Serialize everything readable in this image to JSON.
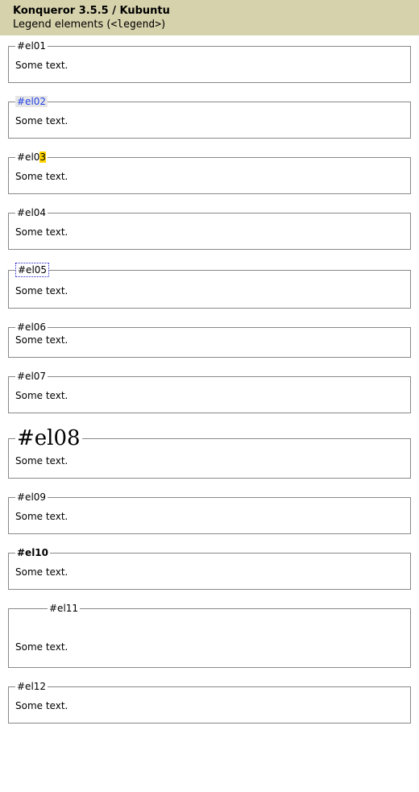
{
  "header": {
    "title": "Konqueror 3.5.5 / Kubuntu",
    "subtitle_prefix": "Legend elements (",
    "subtitle_code": "<legend>",
    "subtitle_suffix": ")"
  },
  "body_text": "Some text.",
  "items": {
    "el01": {
      "label": "#el01"
    },
    "el02": {
      "label": "#el02"
    },
    "el03": {
      "label_main": "#el0",
      "label_hl": "3"
    },
    "el04": {
      "label": "#el04"
    },
    "el05": {
      "label": "#el05"
    },
    "el06": {
      "label": "#el06"
    },
    "el07": {
      "label": "#el07"
    },
    "el08": {
      "label": "#el08"
    },
    "el09": {
      "label": "#el09"
    },
    "el10": {
      "label": "#el10"
    },
    "el11": {
      "label": "#el11"
    },
    "el12": {
      "label": "#el12"
    }
  }
}
